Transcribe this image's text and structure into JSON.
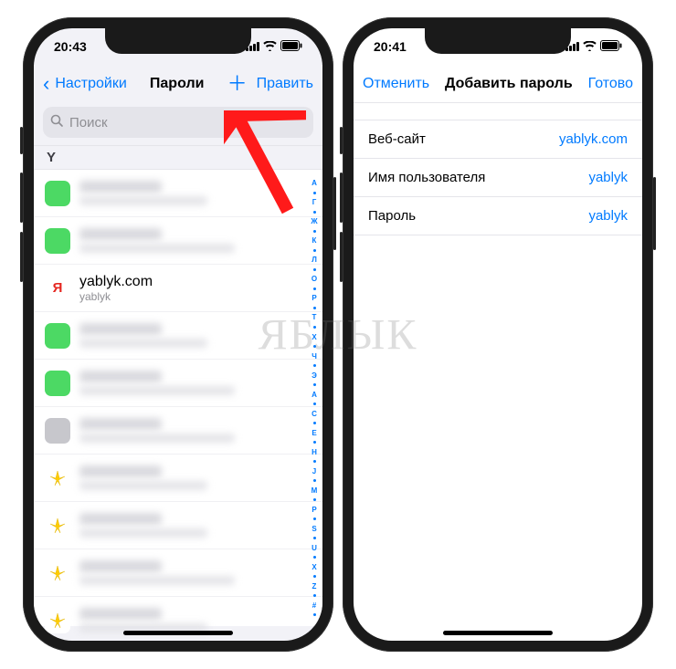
{
  "watermark": "ЯБЛЫК",
  "left": {
    "time": "20:43",
    "back": "Настройки",
    "title": "Пароли",
    "edit": "Править",
    "search_placeholder": "Поиск",
    "section": "Y",
    "visible_row": {
      "site": "yablyk.com",
      "user": "yablyk"
    },
    "index_letters": [
      "А",
      "Г",
      "Ж",
      "К",
      "Л",
      "О",
      "Р",
      "Т",
      "Х",
      "Ч",
      "Э",
      "A",
      "C",
      "E",
      "H",
      "J",
      "M",
      "P",
      "S",
      "U",
      "X",
      "Z",
      "#"
    ]
  },
  "right": {
    "time": "20:41",
    "cancel": "Отменить",
    "title": "Добавить пароль",
    "done": "Готово",
    "rows": {
      "website_k": "Веб-сайт",
      "website_v": "yablyk.com",
      "user_k": "Имя пользователя",
      "user_v": "yablyk",
      "pass_k": "Пароль",
      "pass_v": "yablyk"
    }
  }
}
